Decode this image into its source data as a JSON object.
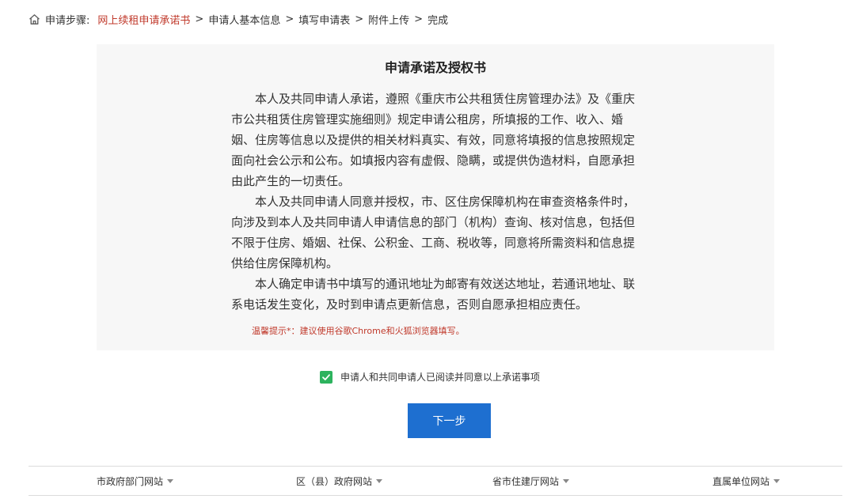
{
  "breadcrumb": {
    "label": "申请步骤:",
    "steps": [
      "网上续租申请承诺书",
      "申请人基本信息",
      "填写申请表",
      "附件上传",
      "完成"
    ],
    "separator": ">",
    "current_color": "#c0392b"
  },
  "document": {
    "title": "申请承诺及授权书",
    "paragraphs": [
      "本人及共同申请人承诺，遵照《重庆市公共租赁住房管理办法》及《重庆市公共租赁住房管理实施细则》规定申请公租房，所填报的工作、收入、婚姻、住房等信息以及提供的相关材料真实、有效，同意将填报的信息按照规定面向社会公示和公布。如填报内容有虚假、隐瞒，或提供伪造材料，自愿承担由此产生的一切责任。",
      "本人及共同申请人同意并授权，市、区住房保障机构在审查资格条件时，向涉及到本人及共同申请人申请信息的部门（机构）查询、核对信息，包括但不限于住房、婚姻、社保、公积金、工商、税收等，同意将所需资料和信息提供给住房保障机构。",
      "本人确定申请书中填写的通讯地址为邮寄有效送达地址，若通讯地址、联系电话发生变化，及时到申请点更新信息，否则自愿承担相应责任。"
    ],
    "tip": "温馨提示*：建议使用谷歌Chrome和火狐浏览器填写。"
  },
  "agreement": {
    "label": "申请人和共同申请人已阅读并同意以上承诺事项",
    "checked": true,
    "check_color": "#2db35e"
  },
  "next_button": {
    "label": "下一步",
    "color": "#1e6fd0"
  },
  "footer": {
    "links": [
      "市政府部门网站",
      "区（县）政府网站",
      "省市住建厅网站",
      "直属单位网站"
    ]
  },
  "icons": {
    "home": "home-icon",
    "check": "check-icon",
    "dropdown": "caret-down-icon"
  }
}
